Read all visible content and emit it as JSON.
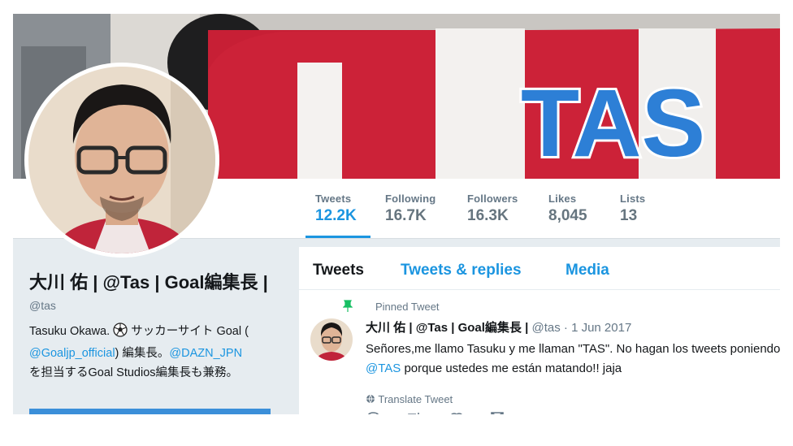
{
  "stats": [
    {
      "label": "Tweets",
      "value": "12.2K"
    },
    {
      "label": "Following",
      "value": "16.7K"
    },
    {
      "label": "Followers",
      "value": "16.3K"
    },
    {
      "label": "Likes",
      "value": "8,045"
    },
    {
      "label": "Lists",
      "value": "13"
    }
  ],
  "banner": {
    "jersey_text": "TAS"
  },
  "profile": {
    "name": "大川 佑 | @Tas | Goal編集長 |",
    "handle": "@tas",
    "bio_line1_prefix": "Tasuku Okawa. ",
    "bio_line1_suffix": " サッカーサイト Goal (",
    "bio_link1": "@Goaljp_official",
    "bio_line2_mid": ") 編集長。",
    "bio_link2": "@DAZN_JPN",
    "bio_line3": "を担当するGoal Studios編集長も兼務。"
  },
  "tabs": [
    "Tweets",
    "Tweets & replies",
    "Media"
  ],
  "tweet": {
    "pinned_label": "Pinned Tweet",
    "author_name": "大川 佑 | @Tas | Goal編集長 |",
    "author_handle": "@tas",
    "separator": " · ",
    "date": "1 Jun 2017",
    "text_line1": "Señores,me llamo Tasuku y me llaman \"TAS\". No hagan los tweets poniendo",
    "mention": "@TAS",
    "text_line2": " porque ustedes me están matando!! jaja",
    "translate": "Translate Tweet"
  },
  "colors": {
    "accent": "#1b95e0",
    "jersey_red": "#d3263a",
    "jersey_blue": "#2d7fd6"
  }
}
